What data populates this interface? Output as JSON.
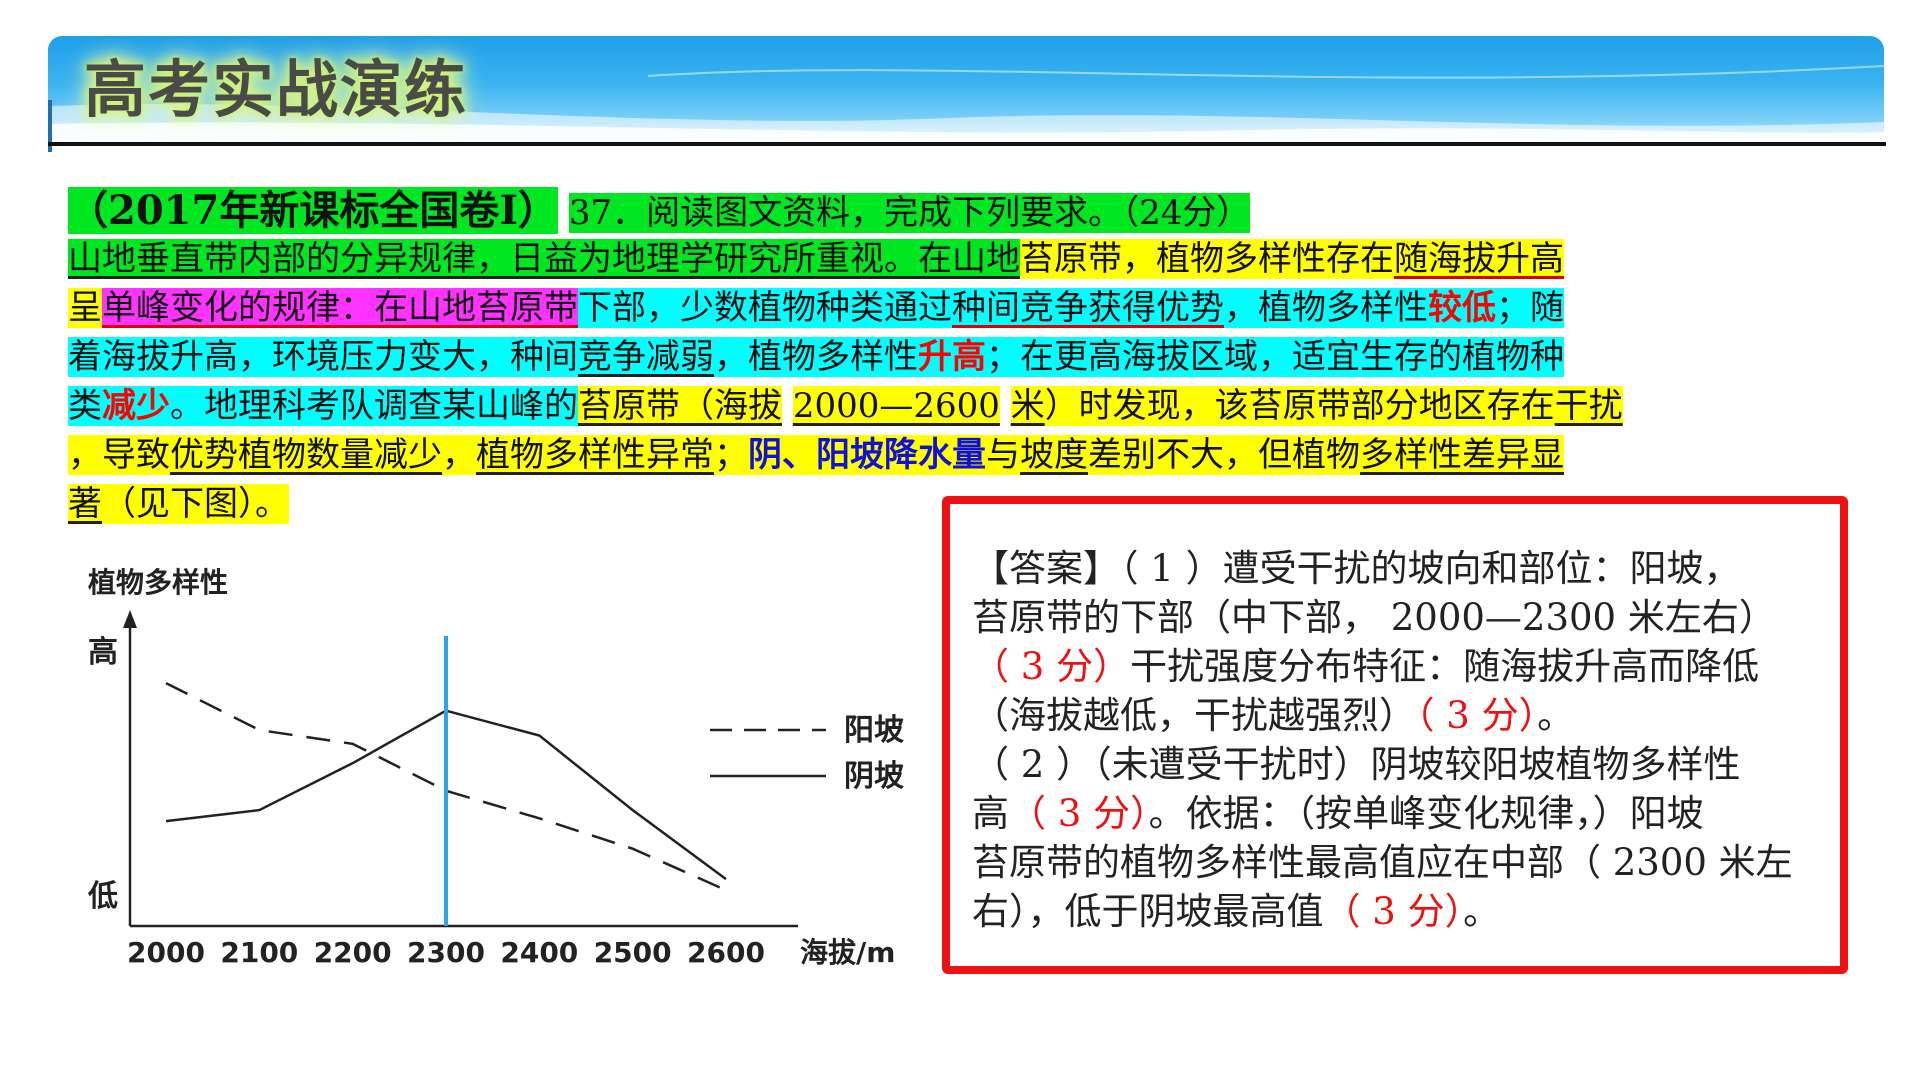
{
  "banner": {
    "title": "高考实战演练"
  },
  "question": {
    "l1": {
      "prefix_open": "（",
      "year": "2017",
      "exam": "年新课标全国卷Ⅰ）",
      "num": "37",
      "dot": "．",
      "task": "阅读图文资料，完成下列要求。（",
      "score": "24",
      "score_unit": "分）"
    },
    "l2": {
      "a": "山地垂直带内部的分异规律，日益为地理学研究所重视。在山地",
      "b": "苔原带，植物多样性存在",
      "c": "随海拔升高"
    },
    "l3": {
      "a": "呈",
      "b": "单峰变化的规律：在山地苔原带",
      "c": "下部，少数植物种类通过",
      "d": "种间竞争获得优势",
      "e": "，植物多样性",
      "f": "较低",
      "g": "；随"
    },
    "l4": {
      "a": "着海拔升高，环境压力变大，种间",
      "b": "竞争减弱",
      "c": "，植物多样性",
      "d": "升高",
      "e": "；在更高海拔区域，适宜生存的植物种"
    },
    "l5": {
      "a": "类",
      "b": "减少",
      "c": "。地理科考队调查某山峰的",
      "d": "苔原带（海拔",
      "e": "2000—2600",
      "f": "米",
      "g": "）时发现，该苔原带部分地区存在",
      "h": "干扰"
    },
    "l6": {
      "a": "，导致",
      "b": "优势植物数量减少",
      "c": "，",
      "d": "植物多样性异常",
      "e": "；",
      "f": "阴、阳坡降水量",
      "g": "与",
      "h": "坡度",
      "i": "差别不大，但植物",
      "j": "多样性差异显"
    },
    "l7": {
      "a": "著",
      "b": "（见下图）。"
    }
  },
  "chart": {
    "ylabel": "植物多样性",
    "y_high": "高",
    "y_low": "低",
    "xlabel": "海拔/m",
    "legend": {
      "yang": "阳坡",
      "yin": "阴坡"
    },
    "marker_color": "#2aa5e8"
  },
  "chart_data": {
    "type": "line",
    "x": [
      2000,
      2100,
      2200,
      2300,
      2400,
      2500,
      2600
    ],
    "x_tick_labels": [
      "2000",
      "2100",
      "2200",
      "2300",
      "2400",
      "2500",
      "2600"
    ],
    "y_axis_labels": [
      "低",
      "高"
    ],
    "series": [
      {
        "name": "阳坡",
        "style": "dashed",
        "values": [
          0.88,
          0.71,
          0.66,
          0.49,
          0.39,
          0.28,
          0.13
        ]
      },
      {
        "name": "阴坡",
        "style": "solid",
        "values": [
          0.38,
          0.42,
          0.59,
          0.78,
          0.69,
          0.42,
          0.17
        ]
      }
    ],
    "vertical_marker_x": 2300,
    "ylim": [
      0,
      1
    ],
    "xlabel": "海拔/m",
    "ylabel": "植物多样性",
    "legend_position": "right"
  },
  "answer": {
    "l1": {
      "a": "【答案】（ 1 ）遭受干扰的坡向和部位：阳坡，"
    },
    "l2": {
      "a": "苔原带的下部（中下部， 2000—2300 米左右）"
    },
    "l3": {
      "a": "（ 3 分）",
      "b": "干扰强度分布特征：随海拔升高而降低"
    },
    "l4": {
      "a": "（海拔越低，干扰越强烈）",
      "b": "（ 3 分）",
      "c": "。"
    },
    "l5": {
      "a": "（ 2 ）（未遭受干扰时）阴坡较阳坡植物多样性"
    },
    "l6": {
      "a": "高",
      "b": "（ 3 分）",
      "c": "。依据：（按单峰变化规律，）阳坡"
    },
    "l7": {
      "a": "苔原带的植物多样性最高值应在中部（ 2300 米左"
    },
    "l8": {
      "a": "右），低于阴坡最高值",
      "b": "（ 3 分）",
      "c": "。"
    }
  }
}
